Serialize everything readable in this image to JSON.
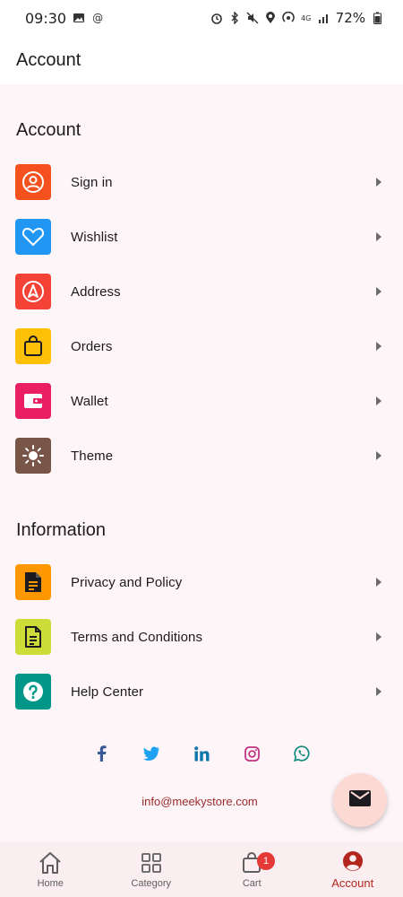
{
  "status_bar": {
    "time": "09:30",
    "battery": "72%"
  },
  "app_bar": {
    "title": "Account"
  },
  "sections": {
    "account": {
      "title": "Account",
      "items": [
        {
          "label": "Sign in",
          "icon": "person-circle-icon",
          "color": "#f4511e"
        },
        {
          "label": "Wishlist",
          "icon": "heart-icon",
          "color": "#2196f3"
        },
        {
          "label": "Address",
          "icon": "navigation-icon",
          "color": "#f44336"
        },
        {
          "label": "Orders",
          "icon": "shopping-bag-icon",
          "color": "#ffc107"
        },
        {
          "label": "Wallet",
          "icon": "wallet-icon",
          "color": "#e91e63"
        },
        {
          "label": "Theme",
          "icon": "sun-icon",
          "color": "#795548"
        }
      ]
    },
    "information": {
      "title": "Information",
      "items": [
        {
          "label": "Privacy and Policy",
          "icon": "document-filled-icon",
          "color": "#ff9800"
        },
        {
          "label": "Terms and Conditions",
          "icon": "document-outline-icon",
          "color": "#cddc39"
        },
        {
          "label": "Help Center",
          "icon": "help-icon",
          "color": "#009688"
        }
      ]
    }
  },
  "social": [
    {
      "name": "facebook-icon",
      "glyph": "f",
      "color": "#3b5998"
    },
    {
      "name": "twitter-icon",
      "glyph": "t",
      "color": "#1da1f2"
    },
    {
      "name": "linkedin-icon",
      "glyph": "in",
      "color": "#0e76a8"
    },
    {
      "name": "instagram-icon",
      "glyph": "ig",
      "color": "#c13584"
    },
    {
      "name": "whatsapp-icon",
      "glyph": "w",
      "color": "#25d366"
    }
  ],
  "contact": {
    "email": "info@meekystore.com"
  },
  "bottom_nav": {
    "items": [
      {
        "label": "Home",
        "icon": "home-icon",
        "active": false
      },
      {
        "label": "Category",
        "icon": "grid-icon",
        "active": false
      },
      {
        "label": "Cart",
        "icon": "cart-icon",
        "active": false,
        "badge": "1"
      },
      {
        "label": "Account",
        "icon": "account-icon",
        "active": true
      }
    ]
  }
}
